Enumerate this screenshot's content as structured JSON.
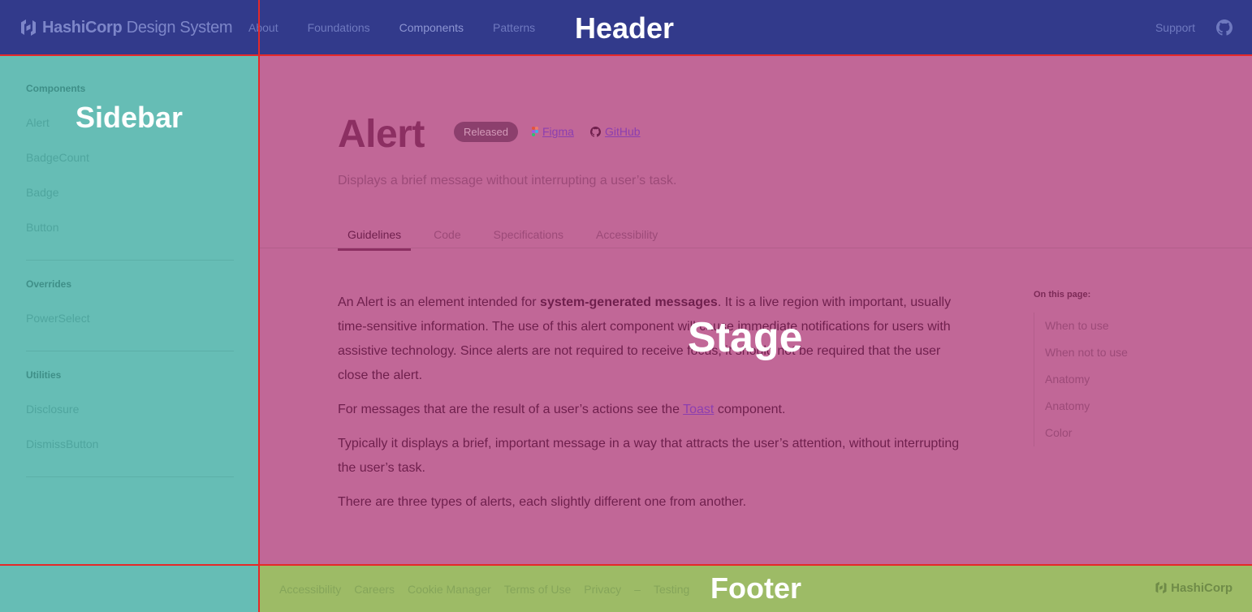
{
  "colors": {
    "header_bg": "#323a8b",
    "sidebar_bg": "#66bdb5",
    "stage_bg": "#c16797",
    "footer_bg": "#9dbb66",
    "region_border": "#e52929"
  },
  "header": {
    "logo_bold": "HashiCorp",
    "logo_light": "Design System",
    "nav": [
      "About",
      "Foundations",
      "Components",
      "Patterns"
    ],
    "support": "Support",
    "github_icon": "github-icon"
  },
  "sidebar": {
    "sections": [
      {
        "heading": "Components",
        "items": [
          "Alert",
          "BadgeCount",
          "Badge",
          "Button"
        ]
      },
      {
        "heading": "Overrides",
        "items": [
          "PowerSelect"
        ]
      },
      {
        "heading": "Utilities",
        "items": [
          "Disclosure",
          "DismissButton"
        ]
      }
    ]
  },
  "stage": {
    "title": "Alert",
    "badge": "Released",
    "figma": "Figma",
    "github": "GitHub",
    "subtitle": "Displays a brief message without interrupting a user’s task.",
    "tabs": [
      "Guidelines",
      "Code",
      "Specifications",
      "Accessibility"
    ],
    "content": {
      "p1_a": "An Alert is an element intended for ",
      "p1_bold": "system-generated messages",
      "p1_b": ". It is a live region with important, usually time-sensitive information. The use of this alert component will cause immediate notifications for users with assistive technology. Since alerts are not required to receive focus, it should not be required that the user close the alert.",
      "p2_a": "For messages that are the result of a user’s actions see the ",
      "p2_link": "Toast",
      "p2_b": " component.",
      "p3": "Typically it displays a brief, important message in a way that attracts the user’s attention, without interrupting the user’s task.",
      "p4": "There are three types of alerts, each slightly different one from another."
    },
    "toc": {
      "heading": "On this page:",
      "items": [
        "When to use",
        "When not to use",
        "Anatomy",
        "Anatomy",
        "Color"
      ]
    }
  },
  "footer": {
    "links": [
      "Accessibility",
      "Careers",
      "Cookie Manager",
      "Terms of Use",
      "Privacy",
      "–",
      "Testing"
    ],
    "brand": "HashiCorp"
  },
  "overlay_labels": {
    "header": "Header",
    "sidebar": "Sidebar",
    "stage": "Stage",
    "footer": "Footer"
  }
}
